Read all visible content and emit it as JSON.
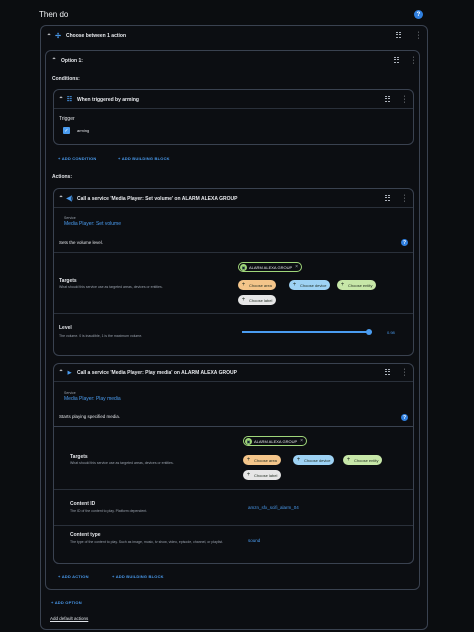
{
  "page": {
    "title": "Then do"
  },
  "choose": {
    "title": "Choose between 1 action"
  },
  "option": {
    "title": "Option 1:"
  },
  "conditions": {
    "label": "Conditions:",
    "trigger_card": {
      "title": "When triggered by arming",
      "trigger_label": "Trigger",
      "checkbox_label": "arming"
    },
    "add_condition": "ADD CONDITION",
    "add_building_block": "ADD BUILDING BLOCK"
  },
  "actions": {
    "label": "Actions:",
    "volume": {
      "title": "Call a service 'Media Player: Set volume' on ALARM ALEXA GROUP",
      "service_label": "Service",
      "service_value": "Media Player: Set volume",
      "description": "Sets the volume level.",
      "targets_title": "Targets",
      "targets_desc": "What should this service use as targeted areas, devices or entities.",
      "entity": "ALARM ALEXA GROUP",
      "choose_area": "Choose area",
      "choose_device": "Choose device",
      "choose_entity": "Choose entity",
      "choose_label": "Choose label",
      "level_title": "Level",
      "level_desc": "The volume. 0 is inaudible, 1 is the maximum volume.",
      "level_value": "0.98",
      "level_fraction": 0.98
    },
    "play": {
      "title": "Call a service 'Media Player: Play media' on ALARM ALEXA GROUP",
      "service_label": "Service",
      "service_value": "Media Player: Play media",
      "description": "Starts playing specified media.",
      "targets_title": "Targets",
      "targets_desc": "What should this service use as targeted areas, devices or entities.",
      "entity": "ALARM ALEXA GROUP",
      "choose_area": "Choose area",
      "choose_device": "Choose device",
      "choose_entity": "Choose entity",
      "choose_label": "Choose label",
      "content_id_title": "Content ID",
      "content_id_desc": "The ID of the content to play. Platform dependent.",
      "content_id_value": "amzn_sfx_scifi_alarm_04",
      "content_type_title": "Content type",
      "content_type_desc": "The type of the content to play. Such as image, music, tv show, video, episode, channel, or playlist.",
      "content_type_value": "sound"
    },
    "add_action": "ADD ACTION",
    "add_building_block": "ADD BUILDING BLOCK"
  },
  "add_option": "ADD OPTION",
  "add_default_actions": "Add default actions",
  "colors": {
    "accent": "#4a9cf0",
    "chip_area": "#f4c58a",
    "chip_device": "#9ed2f4",
    "chip_entity": "#c7e7a8",
    "chip_label": "#e6e6e6"
  }
}
